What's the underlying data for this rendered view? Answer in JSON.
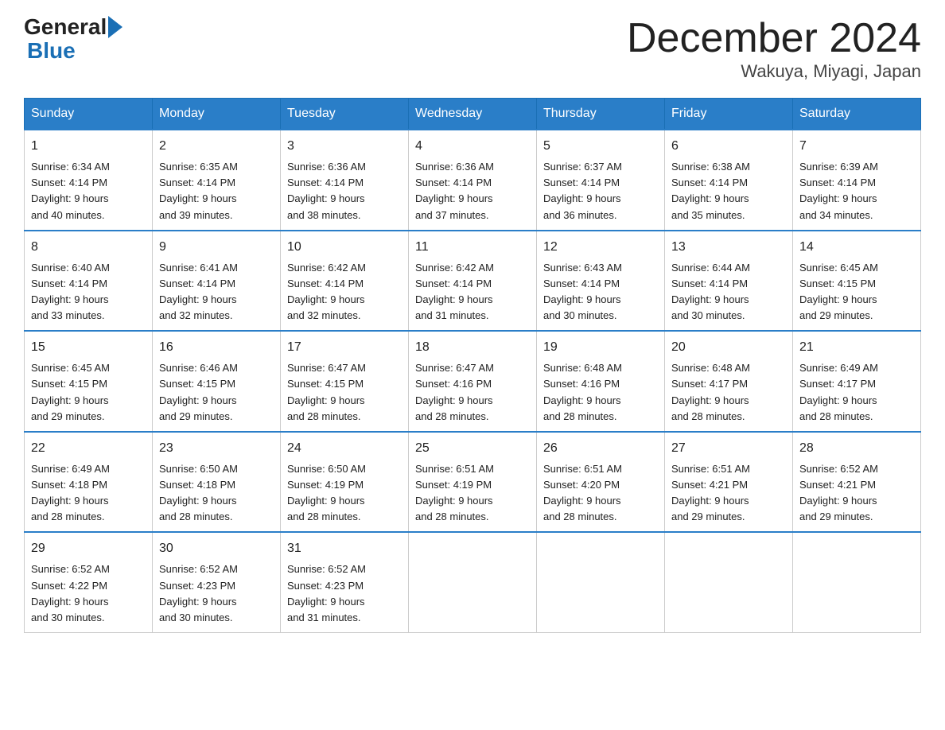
{
  "header": {
    "logo_general": "General",
    "logo_blue": "Blue",
    "month_title": "December 2024",
    "location": "Wakuya, Miyagi, Japan"
  },
  "days_of_week": [
    "Sunday",
    "Monday",
    "Tuesday",
    "Wednesday",
    "Thursday",
    "Friday",
    "Saturday"
  ],
  "weeks": [
    [
      {
        "day": "1",
        "sunrise": "6:34 AM",
        "sunset": "4:14 PM",
        "daylight": "9 hours and 40 minutes."
      },
      {
        "day": "2",
        "sunrise": "6:35 AM",
        "sunset": "4:14 PM",
        "daylight": "9 hours and 39 minutes."
      },
      {
        "day": "3",
        "sunrise": "6:36 AM",
        "sunset": "4:14 PM",
        "daylight": "9 hours and 38 minutes."
      },
      {
        "day": "4",
        "sunrise": "6:36 AM",
        "sunset": "4:14 PM",
        "daylight": "9 hours and 37 minutes."
      },
      {
        "day": "5",
        "sunrise": "6:37 AM",
        "sunset": "4:14 PM",
        "daylight": "9 hours and 36 minutes."
      },
      {
        "day": "6",
        "sunrise": "6:38 AM",
        "sunset": "4:14 PM",
        "daylight": "9 hours and 35 minutes."
      },
      {
        "day": "7",
        "sunrise": "6:39 AM",
        "sunset": "4:14 PM",
        "daylight": "9 hours and 34 minutes."
      }
    ],
    [
      {
        "day": "8",
        "sunrise": "6:40 AM",
        "sunset": "4:14 PM",
        "daylight": "9 hours and 33 minutes."
      },
      {
        "day": "9",
        "sunrise": "6:41 AM",
        "sunset": "4:14 PM",
        "daylight": "9 hours and 32 minutes."
      },
      {
        "day": "10",
        "sunrise": "6:42 AM",
        "sunset": "4:14 PM",
        "daylight": "9 hours and 32 minutes."
      },
      {
        "day": "11",
        "sunrise": "6:42 AM",
        "sunset": "4:14 PM",
        "daylight": "9 hours and 31 minutes."
      },
      {
        "day": "12",
        "sunrise": "6:43 AM",
        "sunset": "4:14 PM",
        "daylight": "9 hours and 30 minutes."
      },
      {
        "day": "13",
        "sunrise": "6:44 AM",
        "sunset": "4:14 PM",
        "daylight": "9 hours and 30 minutes."
      },
      {
        "day": "14",
        "sunrise": "6:45 AM",
        "sunset": "4:15 PM",
        "daylight": "9 hours and 29 minutes."
      }
    ],
    [
      {
        "day": "15",
        "sunrise": "6:45 AM",
        "sunset": "4:15 PM",
        "daylight": "9 hours and 29 minutes."
      },
      {
        "day": "16",
        "sunrise": "6:46 AM",
        "sunset": "4:15 PM",
        "daylight": "9 hours and 29 minutes."
      },
      {
        "day": "17",
        "sunrise": "6:47 AM",
        "sunset": "4:15 PM",
        "daylight": "9 hours and 28 minutes."
      },
      {
        "day": "18",
        "sunrise": "6:47 AM",
        "sunset": "4:16 PM",
        "daylight": "9 hours and 28 minutes."
      },
      {
        "day": "19",
        "sunrise": "6:48 AM",
        "sunset": "4:16 PM",
        "daylight": "9 hours and 28 minutes."
      },
      {
        "day": "20",
        "sunrise": "6:48 AM",
        "sunset": "4:17 PM",
        "daylight": "9 hours and 28 minutes."
      },
      {
        "day": "21",
        "sunrise": "6:49 AM",
        "sunset": "4:17 PM",
        "daylight": "9 hours and 28 minutes."
      }
    ],
    [
      {
        "day": "22",
        "sunrise": "6:49 AM",
        "sunset": "4:18 PM",
        "daylight": "9 hours and 28 minutes."
      },
      {
        "day": "23",
        "sunrise": "6:50 AM",
        "sunset": "4:18 PM",
        "daylight": "9 hours and 28 minutes."
      },
      {
        "day": "24",
        "sunrise": "6:50 AM",
        "sunset": "4:19 PM",
        "daylight": "9 hours and 28 minutes."
      },
      {
        "day": "25",
        "sunrise": "6:51 AM",
        "sunset": "4:19 PM",
        "daylight": "9 hours and 28 minutes."
      },
      {
        "day": "26",
        "sunrise": "6:51 AM",
        "sunset": "4:20 PM",
        "daylight": "9 hours and 28 minutes."
      },
      {
        "day": "27",
        "sunrise": "6:51 AM",
        "sunset": "4:21 PM",
        "daylight": "9 hours and 29 minutes."
      },
      {
        "day": "28",
        "sunrise": "6:52 AM",
        "sunset": "4:21 PM",
        "daylight": "9 hours and 29 minutes."
      }
    ],
    [
      {
        "day": "29",
        "sunrise": "6:52 AM",
        "sunset": "4:22 PM",
        "daylight": "9 hours and 30 minutes."
      },
      {
        "day": "30",
        "sunrise": "6:52 AM",
        "sunset": "4:23 PM",
        "daylight": "9 hours and 30 minutes."
      },
      {
        "day": "31",
        "sunrise": "6:52 AM",
        "sunset": "4:23 PM",
        "daylight": "9 hours and 31 minutes."
      },
      null,
      null,
      null,
      null
    ]
  ],
  "labels": {
    "sunrise": "Sunrise:",
    "sunset": "Sunset:",
    "daylight": "Daylight:"
  }
}
